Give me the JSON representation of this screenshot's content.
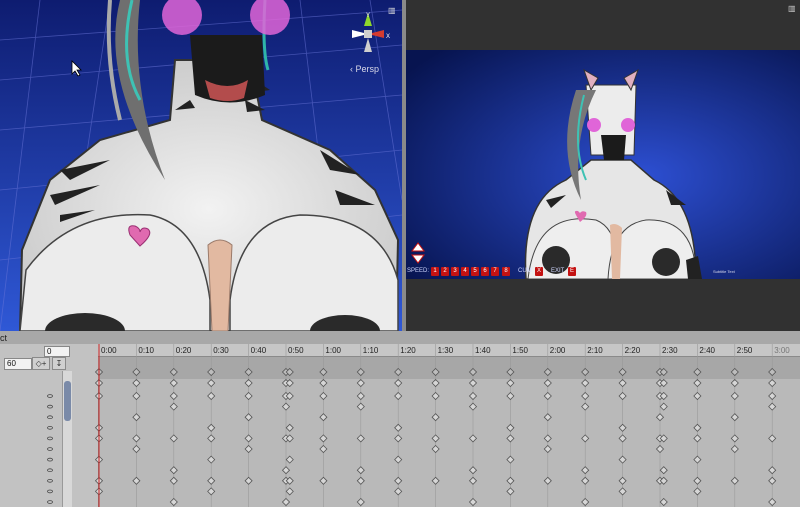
{
  "scene_view": {
    "axis_labels": [
      "Y",
      "X"
    ],
    "persp_label": "‹ Persp"
  },
  "game_view": {
    "hud": {
      "speed_label": "SPEED:",
      "speed_buttons": [
        "1",
        "2",
        "3",
        "4",
        "5",
        "6",
        "7",
        "8"
      ],
      "cum_label": "CUM",
      "cum_button": "X",
      "exit_label": "EXIT",
      "exit_button": "E",
      "watermark": "Subtitle Text"
    }
  },
  "animation": {
    "tab_label": "ct",
    "frame_value": "0",
    "samples_value": "60",
    "timeline": {
      "ticks": [
        "0:00",
        "0:10",
        "0:20",
        "0:30",
        "0:40",
        "0:50",
        "1:00",
        "1:10",
        "1:20",
        "1:30",
        "1:40",
        "1:50",
        "2:00",
        "2:10",
        "2:20",
        "2:30",
        "2:40",
        "2:50",
        "3:00"
      ],
      "end_label": "3:00",
      "keyframe_times": [
        0,
        10,
        20,
        30,
        40,
        50,
        51,
        60,
        70,
        80,
        90,
        100,
        110,
        120,
        130,
        140,
        150,
        151,
        160,
        170,
        180
      ],
      "rows": 12
    }
  },
  "colors": {
    "scene_bg_top": "#0f1f7a",
    "scene_bg_bottom": "#2a4fc9",
    "grid": "#6a75d8",
    "accent_red": "#c41212",
    "timeline_bg": "#b9b9b9"
  }
}
